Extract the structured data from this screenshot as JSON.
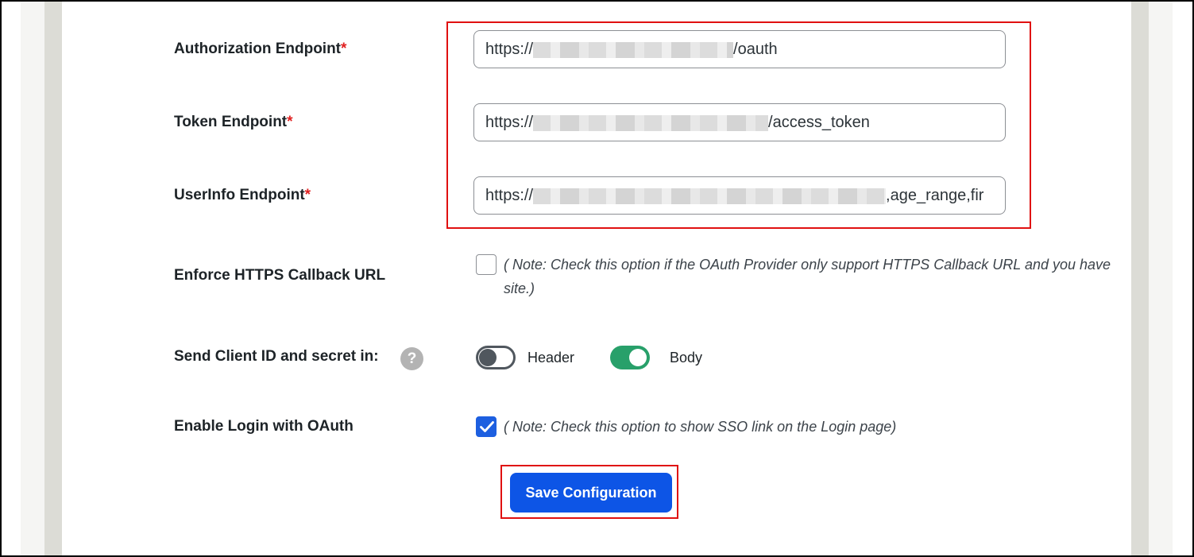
{
  "form": {
    "required_mark": "*",
    "authorization": {
      "label": "Authorization Endpoint",
      "value_prefix": "https://",
      "value_suffix": "/oauth"
    },
    "token": {
      "label": "Token Endpoint",
      "value_prefix": "https://",
      "value_suffix": "/access_token"
    },
    "userinfo": {
      "label": "UserInfo Endpoint",
      "value_prefix": "https://",
      "value_suffix": ",age_range,fir"
    },
    "enforce_https": {
      "label": "Enforce HTTPS Callback URL",
      "checked": false,
      "note_line1": "( Note: Check this option if the OAuth Provider only support HTTPS Callback URL and you have",
      "note_line2": "site.)"
    },
    "send_client": {
      "label": "Send Client ID and secret in:",
      "help_icon": "?",
      "header_label": "Header",
      "header_on": false,
      "body_label": "Body",
      "body_on": true
    },
    "enable_login": {
      "label": "Enable Login with OAuth",
      "checked": true,
      "note": "( Note: Check this option to show SSO link on the Login page)"
    },
    "save_button": "Save Configuration"
  },
  "colors": {
    "accent": "#0d55e6",
    "toggle_on": "#28a06a",
    "required": "#e02020",
    "highlight": "#e01010"
  }
}
